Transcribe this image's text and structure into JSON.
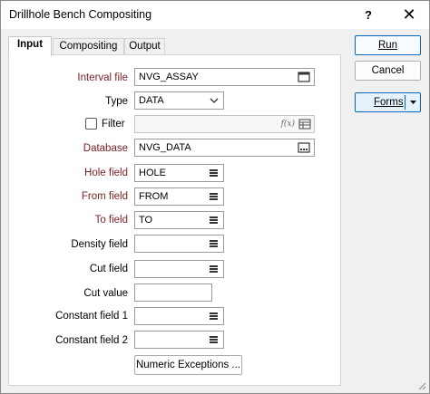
{
  "window": {
    "title": "Drillhole Bench Compositing",
    "help_label": "?",
    "close_label": "✕"
  },
  "tabs": [
    {
      "label": "Input",
      "active": true
    },
    {
      "label": "Compositing",
      "active": false
    },
    {
      "label": "Output",
      "active": false
    }
  ],
  "form": {
    "interval_file": {
      "label": "Interval file",
      "value": "NVG_ASSAY"
    },
    "type": {
      "label": "Type",
      "value": "DATA"
    },
    "filter": {
      "label": "Filter",
      "checked": false,
      "value": ""
    },
    "database": {
      "label": "Database",
      "value": "NVG_DATA"
    },
    "hole_field": {
      "label": "Hole field",
      "value": "HOLE"
    },
    "from_field": {
      "label": "From field",
      "value": "FROM"
    },
    "to_field": {
      "label": "To field",
      "value": "TO"
    },
    "density_field": {
      "label": "Density field",
      "value": ""
    },
    "cut_field": {
      "label": "Cut field",
      "value": ""
    },
    "cut_value": {
      "label": "Cut value",
      "value": ""
    },
    "constant_field_1": {
      "label": "Constant field 1",
      "value": ""
    },
    "constant_field_2": {
      "label": "Constant field 2",
      "value": ""
    },
    "numeric_exceptions_label": "Numeric Exceptions ...",
    "filter_fx_label": "f(x)"
  },
  "actions": {
    "run_label": "Run",
    "cancel_label": "Cancel",
    "forms_label": "Forms"
  },
  "colors": {
    "required_label": "#7a1f1f",
    "accent": "#0067c0"
  }
}
